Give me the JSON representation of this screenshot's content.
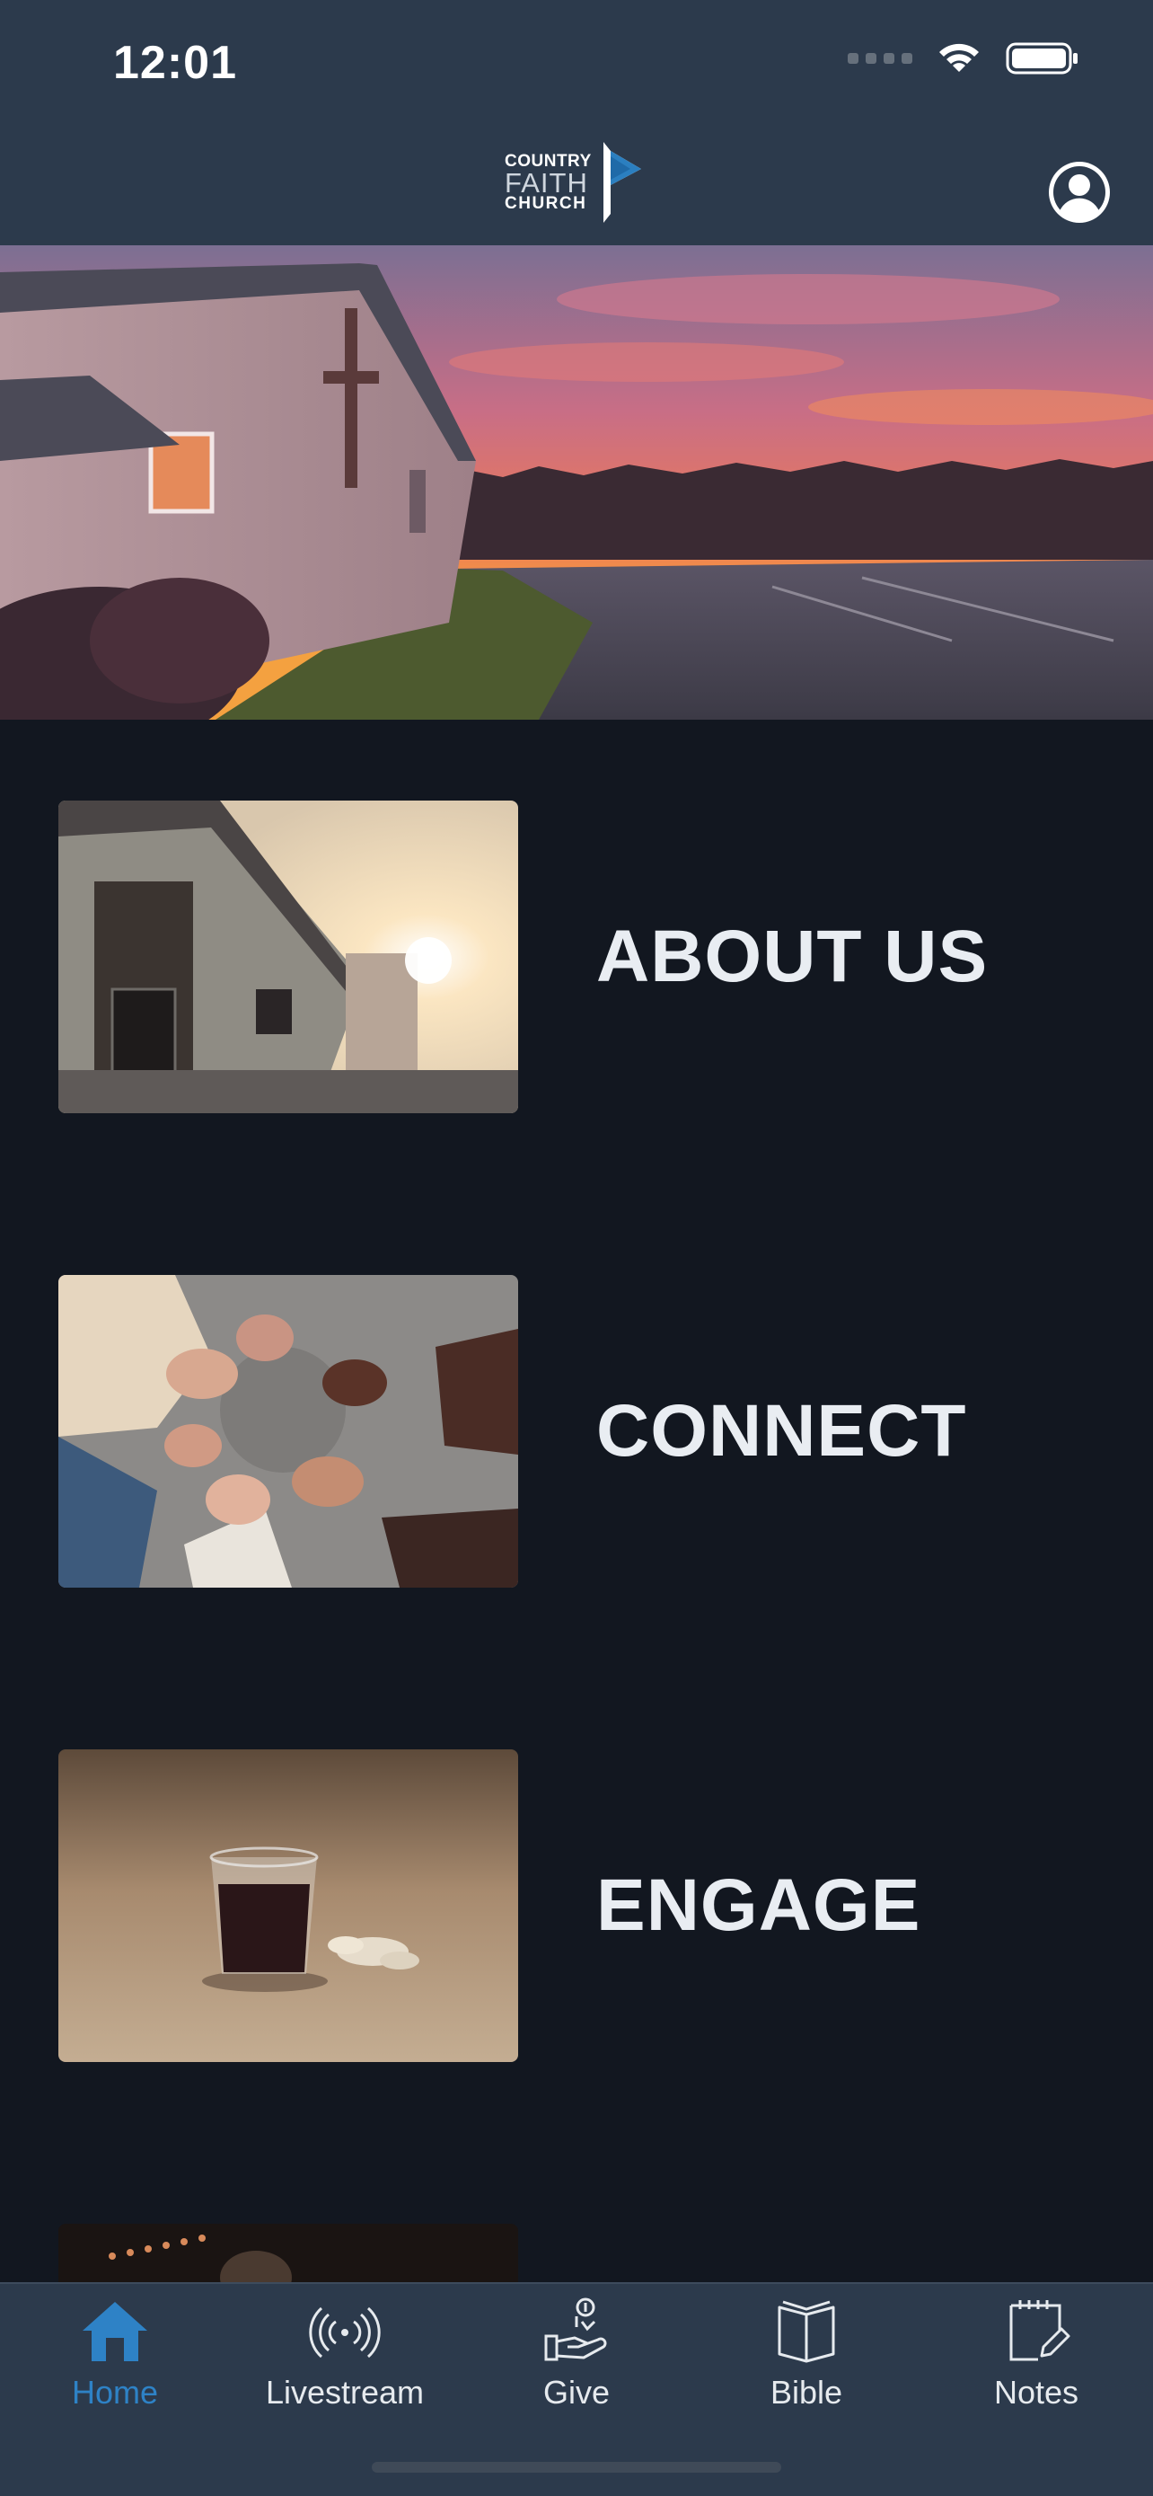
{
  "status_bar": {
    "time": "12:01"
  },
  "header": {
    "logo": {
      "line1": "COUNTRY",
      "line2": "FAITH",
      "line3": "CHURCH"
    },
    "profile_icon": "user-circle-icon"
  },
  "hero": {
    "image": "church-sunset-photo"
  },
  "sections": [
    {
      "label": "ABOUT US",
      "image": "church-entrance-photo"
    },
    {
      "label": "CONNECT",
      "image": "holding-hands-photo"
    },
    {
      "label": "ENGAGE",
      "image": "communion-cup-photo"
    },
    {
      "label": "",
      "image": "worship-concert-photo"
    }
  ],
  "tabbar": {
    "tabs": [
      {
        "label": "Home",
        "icon": "home-icon",
        "active": true
      },
      {
        "label": "Livestream",
        "icon": "broadcast-icon",
        "active": false
      },
      {
        "label": "Give",
        "icon": "giving-hand-icon",
        "active": false
      },
      {
        "label": "Bible",
        "icon": "book-icon",
        "active": false
      },
      {
        "label": "Notes",
        "icon": "notepad-icon",
        "active": false
      }
    ]
  },
  "colors": {
    "nav_background": "#2c3a4c",
    "content_background": "#121720",
    "active_tab": "#2e82c6",
    "text": "#e9edf2"
  }
}
